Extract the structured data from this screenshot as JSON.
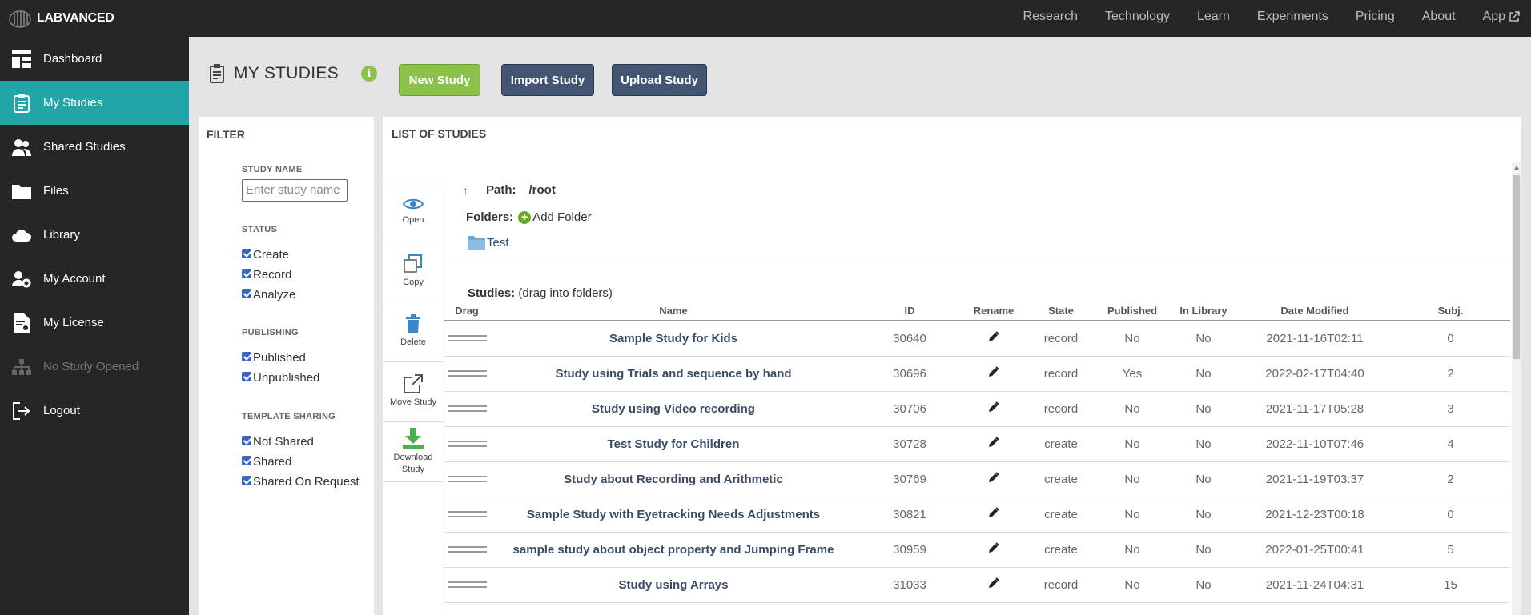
{
  "topbar": {
    "logo": "LABVANCED",
    "nav": [
      {
        "label": "Research"
      },
      {
        "label": "Technology"
      },
      {
        "label": "Learn"
      },
      {
        "label": "Experiments"
      },
      {
        "label": "Pricing"
      },
      {
        "label": "About"
      },
      {
        "label": "App"
      }
    ]
  },
  "sidebar": {
    "items": [
      {
        "label": "Dashboard",
        "icon": "dashboard-icon"
      },
      {
        "label": "My Studies",
        "icon": "clipboard-icon",
        "active": true
      },
      {
        "label": "Shared Studies",
        "icon": "users-icon"
      },
      {
        "label": "Files",
        "icon": "folder-icon"
      },
      {
        "label": "Library",
        "icon": "cloud-icon"
      },
      {
        "label": "My Account",
        "icon": "user-gear-icon"
      },
      {
        "label": "My License",
        "icon": "license-icon"
      },
      {
        "label": "No Study Opened",
        "icon": "sitemap-icon",
        "disabled": true
      },
      {
        "label": "Logout",
        "icon": "logout-icon"
      }
    ]
  },
  "header": {
    "title": "MY STUDIES",
    "info": "i",
    "buttons": {
      "new": "New Study",
      "import": "Import Study",
      "upload": "Upload Study"
    }
  },
  "colors": {
    "accent": "#21a5a6",
    "green": "#8bc34a",
    "navy": "#445573",
    "dark": "#262626"
  },
  "filter": {
    "title": "FILTER",
    "study_name_label": "STUDY NAME",
    "study_name_placeholder": "Enter study name",
    "status_label": "STATUS",
    "status": [
      "Create",
      "Record",
      "Analyze"
    ],
    "publishing_label": "PUBLISHING",
    "publishing": [
      "Published",
      "Unpublished"
    ],
    "sharing_label": "TEMPLATE SHARING",
    "sharing": [
      "Not Shared",
      "Shared",
      "Shared On Request"
    ]
  },
  "list": {
    "title": "LIST OF STUDIES",
    "tools": [
      {
        "label": "Open",
        "icon": "eye-icon"
      },
      {
        "label": "Copy",
        "icon": "copy-icon"
      },
      {
        "label": "Delete",
        "icon": "trash-icon"
      },
      {
        "label": "Move Study",
        "icon": "move-icon"
      },
      {
        "label": "Download Study",
        "icon": "download-icon"
      }
    ],
    "path_label": "Path:",
    "path": "/root",
    "folders_label": "Folders:",
    "add_folder": "Add Folder",
    "folder_name": "Test",
    "studies_label": "Studies:",
    "studies_hint": "(drag into folders)",
    "columns": [
      "Drag",
      "Name",
      "ID",
      "Rename",
      "State",
      "Published",
      "In Library",
      "Date Modified",
      "Subj."
    ],
    "rows": [
      {
        "name": "Sample Study for Kids",
        "id": "30640",
        "state": "record",
        "published": "No",
        "library": "No",
        "date": "2021-11-16T02:11",
        "subj": "0"
      },
      {
        "name": "Study using Trials and sequence by hand",
        "id": "30696",
        "state": "record",
        "published": "Yes",
        "library": "No",
        "date": "2022-02-17T04:40",
        "subj": "2"
      },
      {
        "name": "Study using Video recording",
        "id": "30706",
        "state": "record",
        "published": "No",
        "library": "No",
        "date": "2021-11-17T05:28",
        "subj": "3"
      },
      {
        "name": "Test Study for Children",
        "id": "30728",
        "state": "create",
        "published": "No",
        "library": "No",
        "date": "2022-11-10T07:46",
        "subj": "4"
      },
      {
        "name": "Study about Recording and Arithmetic",
        "id": "30769",
        "state": "create",
        "published": "No",
        "library": "No",
        "date": "2021-11-19T03:37",
        "subj": "2"
      },
      {
        "name": "Sample Study with Eyetracking Needs Adjustments",
        "id": "30821",
        "state": "create",
        "published": "No",
        "library": "No",
        "date": "2021-12-23T00:18",
        "subj": "0"
      },
      {
        "name": "sample study about object property and Jumping Frame",
        "id": "30959",
        "state": "create",
        "published": "No",
        "library": "No",
        "date": "2022-01-25T00:41",
        "subj": "5"
      },
      {
        "name": "Study using Arrays",
        "id": "31033",
        "state": "record",
        "published": "No",
        "library": "No",
        "date": "2021-11-24T04:31",
        "subj": "15"
      }
    ]
  }
}
